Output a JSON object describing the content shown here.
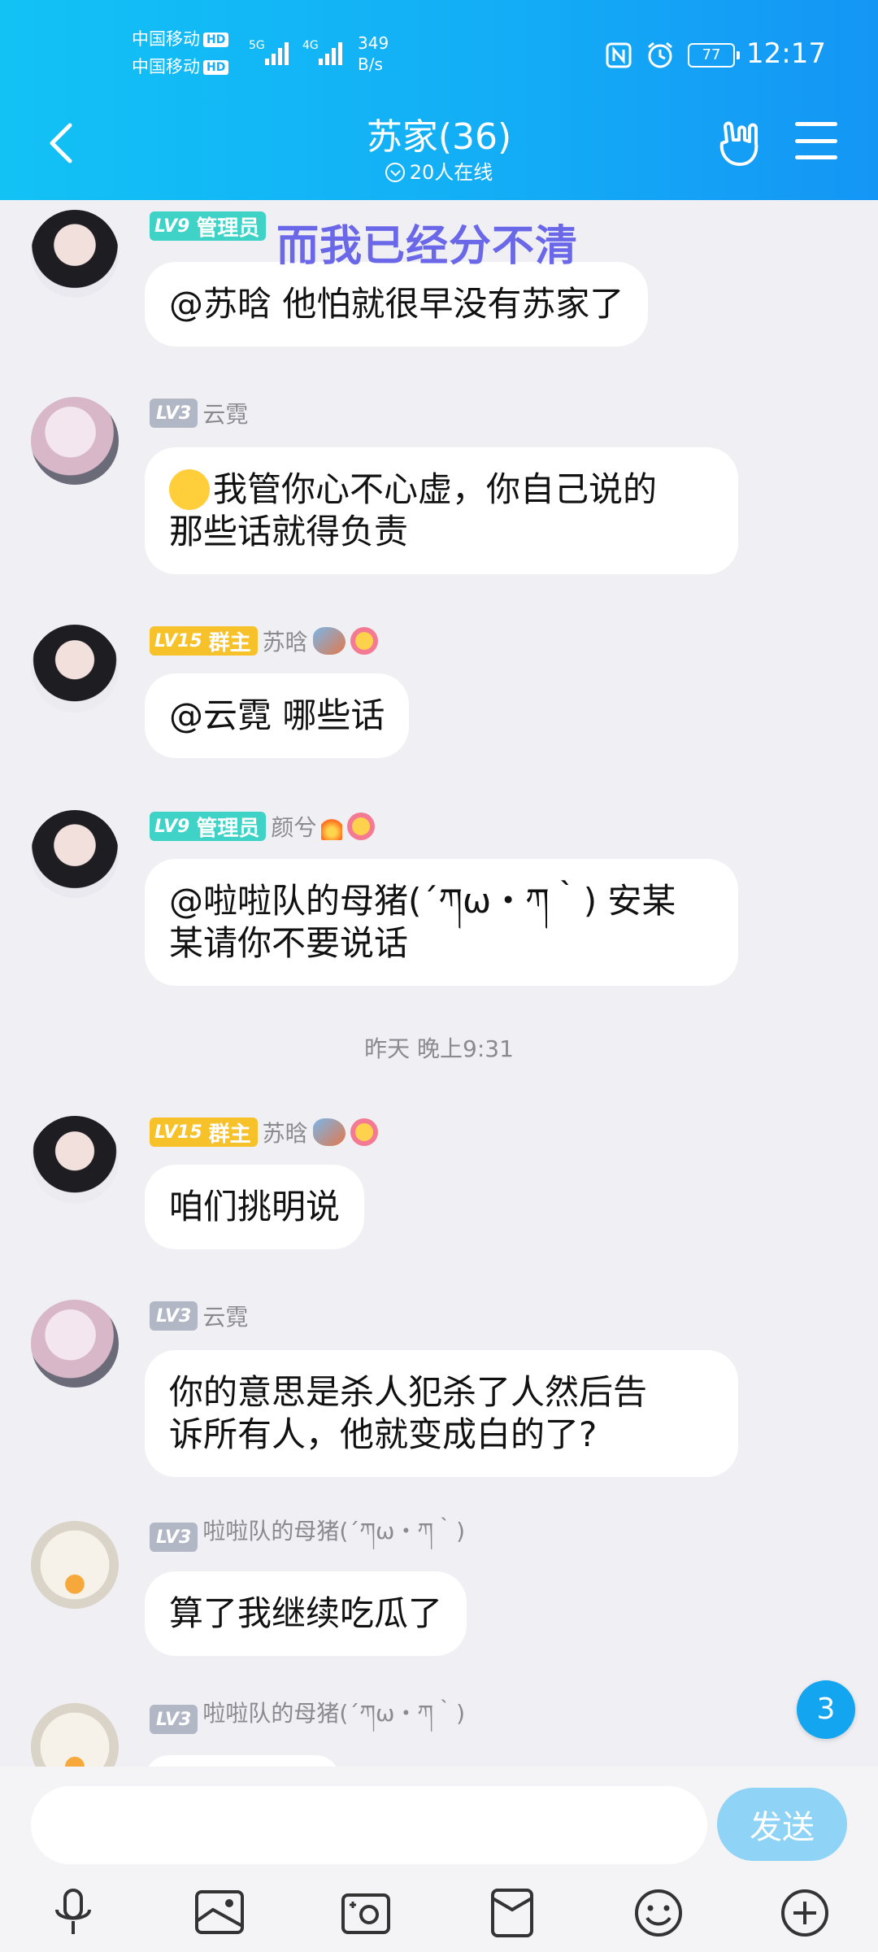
{
  "status_bar": {
    "carrier1": "中国移动",
    "carrier2": "中国移动",
    "hd": "HD",
    "net1": "5G",
    "net2": "4G",
    "speed_value": "349",
    "speed_unit": "B/s",
    "battery": "77",
    "time": "12:17"
  },
  "header": {
    "title": "苏家(36)",
    "online": "20人在线"
  },
  "overlay_text": "而我已经分不清",
  "messages": [
    {
      "badge_lv": "LV9",
      "badge_role": "管理员",
      "sender": "",
      "text": "@苏晗 他怕就很早没有苏家了"
    },
    {
      "badge_lv": "LV3",
      "sender": "云霓",
      "text_line1": "我管你心不心虚，你自己说的",
      "text_line2": "那些话就得负责"
    },
    {
      "badge_lv": "LV15",
      "badge_role": "群主",
      "sender": "苏晗",
      "text": "@云霓 哪些话"
    },
    {
      "badge_lv": "LV9",
      "badge_role": "管理员",
      "sender": "颜兮",
      "text_line1": "@啦啦队的母猪(´ཀω・ཀ｀) 安某",
      "text_line2": "某请你不要说话"
    },
    {
      "badge_lv": "LV15",
      "badge_role": "群主",
      "sender": "苏晗",
      "text": "咱们挑明说"
    },
    {
      "badge_lv": "LV3",
      "sender": "云霓",
      "text_line1": "你的意思是杀人犯杀了人然后告",
      "text_line2": "诉所有人，他就变成白的了?"
    },
    {
      "badge_lv": "LV3",
      "sender": "啦啦队的母猪(´ཀω・ཀ｀)",
      "text": "算了我继续吃瓜了"
    },
    {
      "badge_lv": "LV3",
      "sender": "啦啦队的母猪(´ཀω・ཀ｀)",
      "text": ""
    }
  ],
  "time_divider": "昨天 晚上9:31",
  "unread_count": "3",
  "input": {
    "placeholder": "",
    "send_label": "发送"
  },
  "colors": {
    "header_start": "#12c2f5",
    "header_end": "#1496f5",
    "admin_badge": "#3fd2c6",
    "owner_badge": "#f7c12a",
    "lv3_badge": "#b2b7c6",
    "send_button": "#8fd3f6"
  },
  "icons": [
    "back-icon",
    "hand-gesture-icon",
    "menu-icon",
    "microphone-icon",
    "picture-icon",
    "camera-icon",
    "red-packet-icon",
    "emoji-icon",
    "plus-icon"
  ]
}
